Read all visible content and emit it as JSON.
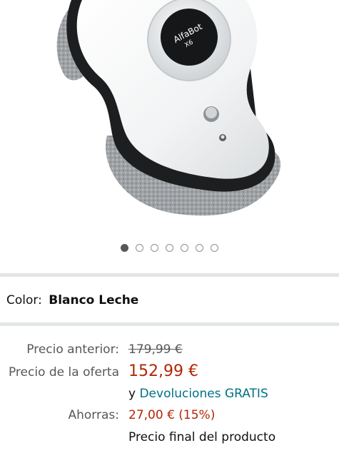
{
  "product": {
    "brand_text": "AlfaBot",
    "model_text": "X6"
  },
  "carousel": {
    "dots": [
      true,
      false,
      false,
      false,
      false,
      false,
      false
    ]
  },
  "color": {
    "label": "Color:",
    "value": "Blanco Leche"
  },
  "pricing": {
    "previous_label": "Precio anterior:",
    "previous_value": "179,99 €",
    "offer_label": "Precio de la oferta",
    "offer_value": "152,99 €",
    "returns_prefix": "y",
    "returns_link": "Devoluciones GRATIS",
    "savings_label": "Ahorras:",
    "savings_value": "27,00 € (15%)",
    "final_note": "Precio final del producto"
  },
  "colors": {
    "price_red": "#B12704",
    "link_teal": "#007185",
    "divider": "#E3E6E6"
  }
}
